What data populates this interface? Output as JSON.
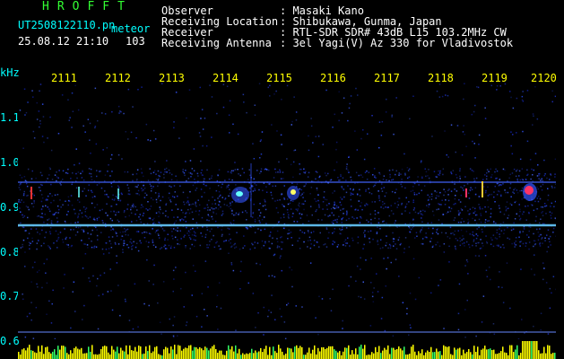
{
  "app": {
    "hroff": "HROFFT",
    "filename": "UT2508122110.pn",
    "meteor_label": "meteor",
    "datetime": "25.08.12 21:10",
    "count": "103"
  },
  "info": {
    "observer_label": "Observer",
    "observer_value": ": Masaki Kano",
    "location_label": "Receiving Location",
    "location_value": ": Shibukawa, Gunma, Japan",
    "receiver_label": "Receiver",
    "receiver_value": ": RTL-SDR SDR# 43dB L15 103.2MHz CW",
    "antenna_label": "Receiving Antenna",
    "antenna_value": ": 3el Yagi(V) Az 330 for Vladivostok"
  },
  "axis": {
    "unit": "kHz",
    "y_ticks": [
      "1.1",
      "1.0",
      "0.9",
      "0.8",
      "0.7",
      "0.6"
    ],
    "x_ticks": [
      "2111",
      "2112",
      "2113",
      "2114",
      "2115",
      "2116",
      "2117",
      "2118",
      "2119",
      "2120"
    ]
  },
  "colors": {
    "background": "#000000",
    "text_white": "#ffffff",
    "text_cyan": "#00ffff",
    "text_green": "#33ff33",
    "signal": "#ffff00"
  }
}
